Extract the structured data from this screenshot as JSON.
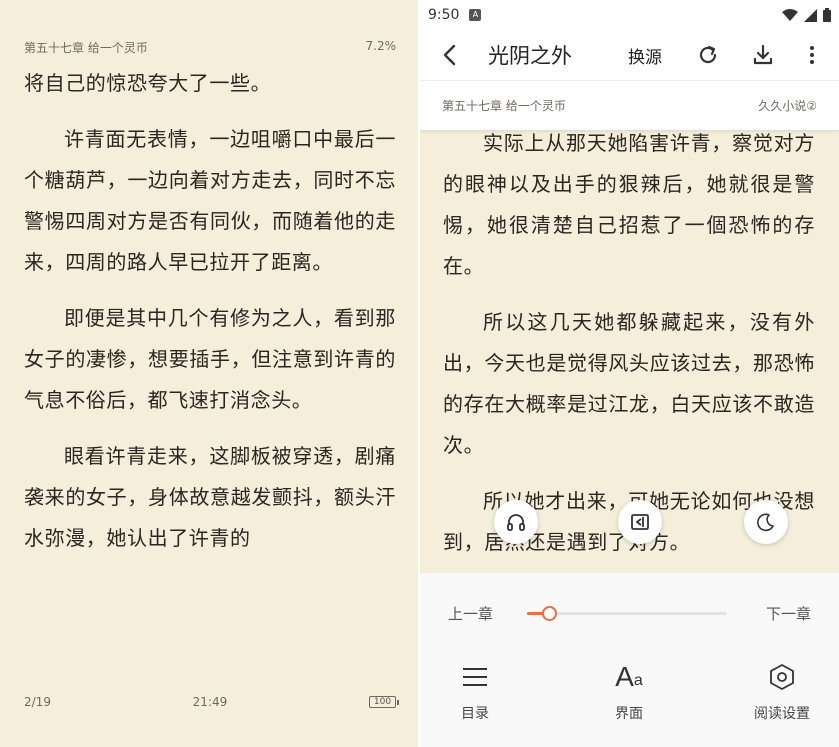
{
  "left_pane": {
    "chapter": "第五十七章 给一个灵币",
    "progress": "7.2%",
    "paragraphs": [
      "将自己的惊恐夸大了一些。",
      "许青面无表情，一边咀嚼口中最后一个糖葫芦，一边向着对方走去，同时不忘警惕四周对方是否有同伙，而随着他的走来，四周的路人早已拉开了距离。",
      "即便是其中几个有修为之人，看到那女子的凄惨，想要插手，但注意到许青的气息不俗后，都飞速打消念头。",
      "眼看许青走来，这脚板被穿透，剧痛袭来的女子，身体故意越发颤抖，额头汗水弥漫，她认出了许青的"
    ],
    "page": "2/19",
    "time": "21:49",
    "battery": "100"
  },
  "right_pane": {
    "status_time": "9:50",
    "status_app_icon": "A",
    "title": "光阴之外",
    "change_source": "换源",
    "chapter": "第五十七章 给一个灵币",
    "source_name": "久久小说②",
    "paragraphs": [
      "实际上从那天她陷害许青，察觉对方的眼神以及出手的狠辣后，她就很是警惕，她很清楚自己招惹了一個恐怖的存在。",
      "所以这几天她都躲藏起来，没有外出，今天也是觉得风头应该过去，那恐怖的存在大概率是过江龙，白天应该不敢造次。",
      "所以她才出来，可她无论如何也没想到，居然还是遇到了对方。"
    ],
    "prev_chapter": "上一章",
    "next_chapter": "下一章",
    "chapter_progress": 0.11,
    "menu": {
      "catalog": "目录",
      "font_glyph": "A",
      "font_glyph_small": "a",
      "interface": "界面",
      "reading_settings": "阅读设置"
    },
    "accent_color": "#f26b3a"
  }
}
